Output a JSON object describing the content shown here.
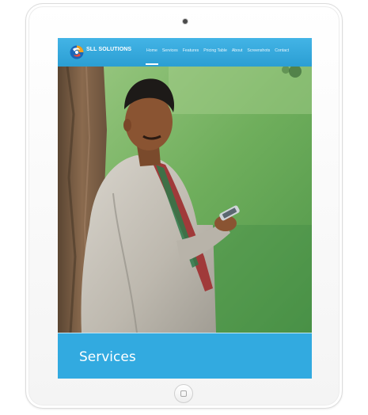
{
  "header": {
    "brand": "SLL SOLUTIONS",
    "nav": [
      {
        "label": "Home",
        "active": true
      },
      {
        "label": "Services",
        "active": false
      },
      {
        "label": "Features",
        "active": false
      },
      {
        "label": "Pricing Table",
        "active": false
      },
      {
        "label": "About",
        "active": false
      },
      {
        "label": "Screenshots",
        "active": false
      },
      {
        "label": "Contact",
        "active": false
      }
    ]
  },
  "section": {
    "title": "Services"
  },
  "icons": {
    "logo": "sll-logo-icon",
    "camera": "camera-icon",
    "home": "home-button-icon"
  },
  "colors": {
    "accent": "#32aae0",
    "header": "#3aaee2",
    "text": "#ffffff"
  }
}
